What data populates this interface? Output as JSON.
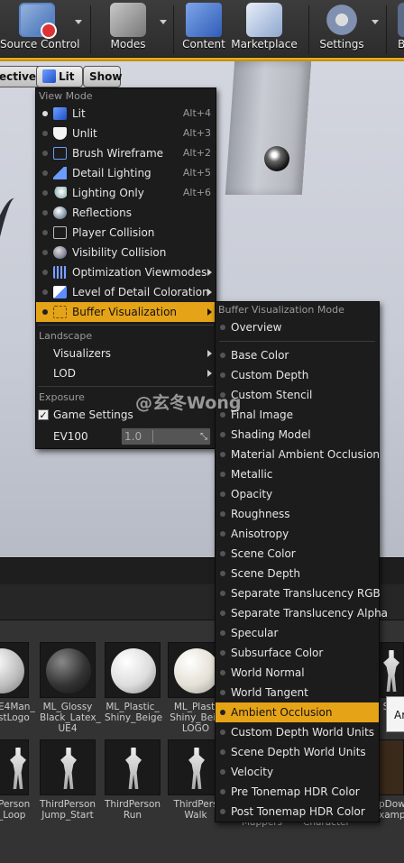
{
  "toolbar": {
    "items": [
      {
        "label": "Source Control",
        "icon": "source-control-icon"
      },
      {
        "label": "Modes",
        "icon": "modes-icon"
      },
      {
        "label": "Content",
        "icon": "content-icon"
      },
      {
        "label": "Marketplace",
        "icon": "marketplace-icon"
      },
      {
        "label": "Settings",
        "icon": "settings-icon"
      },
      {
        "label": "B",
        "icon": "build-icon"
      }
    ]
  },
  "viewport": {
    "perspective_label": "ective",
    "lit_label": "Lit",
    "show_label": "Show"
  },
  "view_menu": {
    "header": "View Mode",
    "modes": [
      {
        "label": "Lit",
        "shortcut": "Alt+4",
        "icon": "lit-cube-icon"
      },
      {
        "label": "Unlit",
        "shortcut": "Alt+3",
        "icon": "unlit-shield-icon"
      },
      {
        "label": "Brush Wireframe",
        "shortcut": "Alt+2",
        "icon": "wireframe-cube-icon"
      },
      {
        "label": "Detail Lighting",
        "shortcut": "Alt+5",
        "icon": "detail-lighting-icon"
      },
      {
        "label": "Lighting Only",
        "shortcut": "Alt+6",
        "icon": "lighting-only-icon"
      },
      {
        "label": "Reflections",
        "shortcut": "",
        "icon": "reflections-sphere-icon"
      },
      {
        "label": "Player Collision",
        "shortcut": "",
        "icon": "player-collision-icon"
      },
      {
        "label": "Visibility Collision",
        "shortcut": "",
        "icon": "visibility-collision-icon"
      },
      {
        "label": "Optimization Viewmodes",
        "shortcut": "",
        "icon": "optimization-icon"
      },
      {
        "label": "Level of Detail Coloration",
        "shortcut": "",
        "icon": "lod-coloration-icon"
      },
      {
        "label": "Buffer Visualization",
        "shortcut": "",
        "icon": "buffer-visualization-icon"
      }
    ],
    "landscape_header": "Landscape",
    "landscape_items": [
      "Visualizers",
      "LOD"
    ],
    "exposure_header": "Exposure",
    "game_settings_label": "Game Settings",
    "game_settings_checked": true,
    "ev100_label": "EV100",
    "ev100_value": "1.0"
  },
  "buffer_menu": {
    "header": "Buffer Visualization Mode",
    "overview": "Overview",
    "items": [
      "Base Color",
      "Custom Depth",
      "Custom Stencil",
      "Final Image",
      "Shading Model",
      "Material Ambient Occlusion",
      "Metallic",
      "Opacity",
      "Roughness",
      "Anisotropy",
      "Scene Color",
      "Scene Depth",
      "Separate Translucency RGB",
      "Separate Translucency Alpha",
      "Specular",
      "Subsurface Color",
      "World Normal",
      "World Tangent",
      "Ambient Occlusion",
      "Custom Depth World Units",
      "Scene Depth World Units",
      "Velocity",
      "Pre Tonemap HDR Color",
      "Post Tonemap HDR Color"
    ],
    "selected": "Ambient Occlusion"
  },
  "watermark": "@玄冬Wong",
  "assets_row1": [
    {
      "label": "E4Man_ stLogo"
    },
    {
      "label": "ML_Glossy Black_Latex_ UE4"
    },
    {
      "label": "ML_Plastic_ Shiny_Beige"
    },
    {
      "label": "ML_Plasti Shiny_Beig LOGO"
    }
  ],
  "assets_row2": [
    {
      "label": "Person _Loop"
    },
    {
      "label": "ThirdPerson Jump_Start"
    },
    {
      "label": "ThirdPerson Run"
    },
    {
      "label": "ThirdPers Walk"
    }
  ],
  "assets_right": [
    {
      "label": "SK_"
    },
    {
      "label": "pDow xample"
    }
  ],
  "tooltip_partial": "Ar",
  "bottom_labels": [
    "Mappers",
    "Character"
  ],
  "colors": {
    "accent": "#e5a317",
    "menu_bg": "#1c1c1c"
  }
}
